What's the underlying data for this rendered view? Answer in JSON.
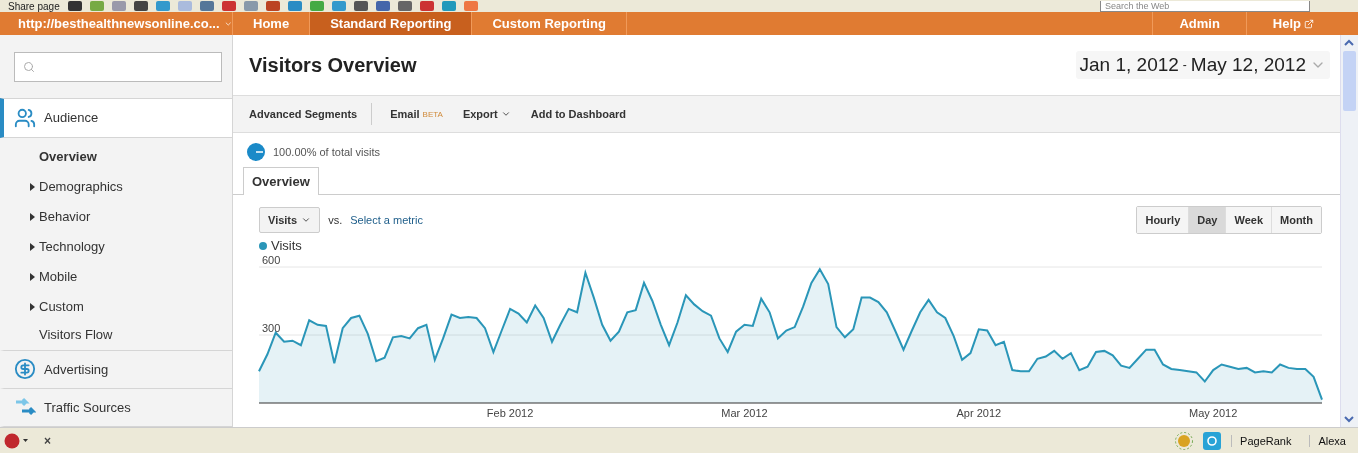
{
  "browser_toolbar": {
    "share_label": "Share page",
    "search": {
      "placeholder": "Search the Web"
    }
  },
  "nav": {
    "site": "http://besthealthnewsonline.co...",
    "tabs": [
      {
        "label": "Home",
        "selected": false
      },
      {
        "label": "Standard Reporting",
        "selected": true
      },
      {
        "label": "Custom Reporting",
        "selected": false
      }
    ],
    "right_links": [
      "Admin",
      "Help"
    ]
  },
  "sidebar": {
    "sections": [
      {
        "label": "Audience",
        "selected": true,
        "expanded": true,
        "children": [
          {
            "label": "Overview",
            "kind": "link",
            "selected": true
          },
          {
            "label": "Demographics",
            "kind": "expandable",
            "selected": false
          },
          {
            "label": "Behavior",
            "kind": "expandable",
            "selected": false
          },
          {
            "label": "Technology",
            "kind": "expandable",
            "selected": false
          },
          {
            "label": "Mobile",
            "kind": "expandable",
            "selected": false
          },
          {
            "label": "Custom",
            "kind": "expandable",
            "selected": false
          },
          {
            "label": "Visitors Flow",
            "kind": "link",
            "selected": false
          }
        ]
      },
      {
        "label": "Advertising",
        "selected": false,
        "expanded": false
      },
      {
        "label": "Traffic Sources",
        "selected": false,
        "expanded": false
      }
    ]
  },
  "main": {
    "title": "Visitors Overview",
    "date_from": "Jan 1, 2012",
    "date_separator": "-",
    "date_to": "May 12, 2012",
    "actions": [
      {
        "label": "Advanced Segments",
        "kind": "plain"
      },
      {
        "label": "Email",
        "badge": "BETA",
        "kind": "badge"
      },
      {
        "label": "Export",
        "kind": "menu"
      },
      {
        "label": "Add to Dashboard",
        "kind": "plain"
      }
    ],
    "segment": "100.00% of total visits",
    "tabs": [
      {
        "label": "Overview",
        "selected": true
      }
    ],
    "metric": "Visits",
    "vs": "vs.",
    "compare_link": "Select a metric",
    "periods": [
      {
        "label": "Hourly",
        "selected": false
      },
      {
        "label": "Day",
        "selected": true
      },
      {
        "label": "Week",
        "selected": false
      },
      {
        "label": "Month",
        "selected": false
      }
    ],
    "chart_data": {
      "type": "area",
      "ylim": [
        0,
        600
      ],
      "yticks": [
        {
          "value": 300,
          "label": "300"
        },
        {
          "value": 600,
          "label": "600"
        }
      ],
      "categories": [
        null,
        null,
        null,
        null,
        null,
        null,
        null,
        null,
        null,
        null,
        null,
        null,
        null,
        null,
        null,
        null,
        null,
        null,
        null,
        null,
        null,
        null,
        null,
        null,
        null,
        null,
        null,
        null,
        null,
        null,
        "Feb 2012",
        null,
        null,
        null,
        null,
        null,
        null,
        null,
        null,
        null,
        null,
        null,
        null,
        null,
        null,
        null,
        null,
        null,
        null,
        null,
        null,
        null,
        null,
        null,
        null,
        null,
        null,
        null,
        "Mar 2012",
        null,
        null,
        null,
        null,
        null,
        null,
        null,
        null,
        null,
        null,
        null,
        null,
        null,
        null,
        null,
        null,
        null,
        null,
        null,
        null,
        null,
        null,
        null,
        null,
        null,
        null,
        null,
        "Apr 2012",
        null,
        null,
        null,
        null,
        null,
        null,
        null,
        null,
        null,
        null,
        null,
        null,
        null,
        null,
        null,
        null,
        null,
        null,
        null,
        null,
        null,
        null,
        null,
        null,
        null,
        null,
        null,
        "May 2012",
        null,
        null,
        null,
        null,
        null,
        null,
        null,
        null,
        null,
        null,
        null,
        null,
        null
      ],
      "series": [
        {
          "name": "Visits",
          "color": "#2a96b8",
          "values": [
            140,
            215,
            310,
            270,
            275,
            255,
            365,
            345,
            340,
            175,
            330,
            375,
            385,
            305,
            185,
            200,
            290,
            295,
            285,
            330,
            345,
            190,
            285,
            390,
            375,
            380,
            375,
            330,
            225,
            320,
            415,
            395,
            355,
            430,
            375,
            270,
            345,
            415,
            400,
            575,
            465,
            345,
            275,
            315,
            400,
            410,
            530,
            450,
            345,
            255,
            355,
            475,
            435,
            405,
            385,
            285,
            225,
            315,
            345,
            340,
            460,
            400,
            285,
            320,
            335,
            425,
            530,
            590,
            525,
            335,
            290,
            325,
            465,
            465,
            445,
            400,
            320,
            235,
            320,
            400,
            455,
            400,
            375,
            295,
            190,
            220,
            325,
            320,
            255,
            270,
            145,
            140,
            140,
            195,
            205,
            230,
            195,
            220,
            145,
            160,
            225,
            230,
            210,
            165,
            155,
            195,
            235,
            235,
            170,
            150,
            145,
            140,
            135,
            95,
            145,
            170,
            160,
            150,
            155,
            135,
            140,
            135,
            170,
            155,
            150,
            150,
            115,
            15
          ]
        }
      ]
    }
  },
  "status_bar": {
    "left": [
      "×"
    ],
    "right": [
      "PageRank",
      "Alexa"
    ]
  }
}
